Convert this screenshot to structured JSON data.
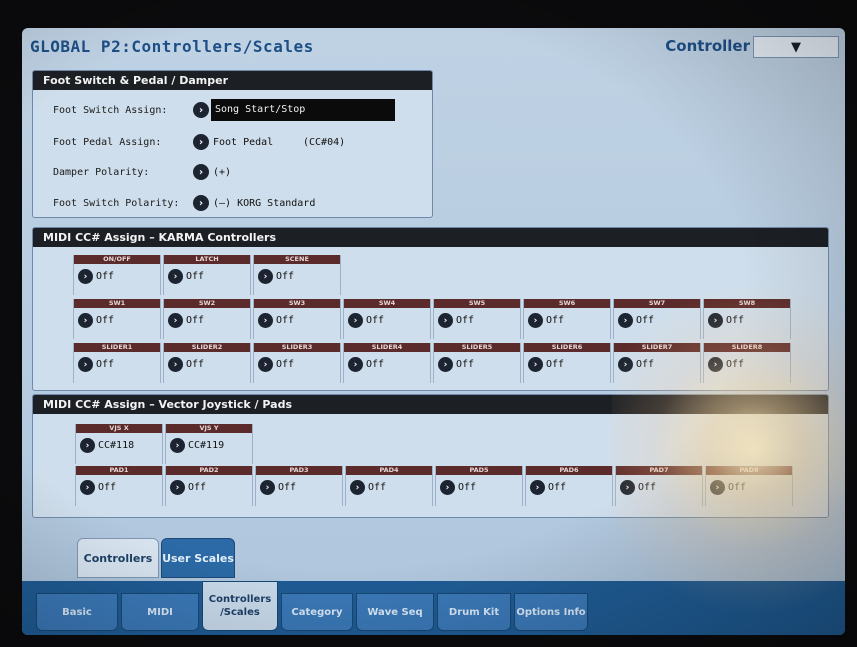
{
  "header": {
    "title": "GLOBAL P2:Controllers/Scales",
    "mode_label": "Controller",
    "mode_select_icon": "chevron-down-icon"
  },
  "foot": {
    "title": "Foot Switch & Pedal / Damper",
    "rows": [
      {
        "label": "Foot Switch Assign:",
        "value": "Song Start/Stop",
        "note": ""
      },
      {
        "label": "Foot Pedal Assign:",
        "value": "Foot Pedal",
        "note": "(CC#04)"
      },
      {
        "label": "Damper Polarity:",
        "value": "(+)",
        "note": ""
      },
      {
        "label": "Foot Switch Polarity:",
        "value": "(–) KORG Standard",
        "note": ""
      }
    ]
  },
  "karma": {
    "title": "MIDI CC# Assign – KARMA Controllers",
    "row1": [
      {
        "label": "ON/OFF",
        "value": "Off"
      },
      {
        "label": "LATCH",
        "value": "Off"
      },
      {
        "label": "SCENE",
        "value": "Off"
      }
    ],
    "row2": [
      {
        "label": "SW1",
        "value": "Off"
      },
      {
        "label": "SW2",
        "value": "Off"
      },
      {
        "label": "SW3",
        "value": "Off"
      },
      {
        "label": "SW4",
        "value": "Off"
      },
      {
        "label": "SW5",
        "value": "Off"
      },
      {
        "label": "SW6",
        "value": "Off"
      },
      {
        "label": "SW7",
        "value": "Off"
      },
      {
        "label": "SW8",
        "value": "Off"
      }
    ],
    "row3": [
      {
        "label": "SLIDER1",
        "value": "Off"
      },
      {
        "label": "SLIDER2",
        "value": "Off"
      },
      {
        "label": "SLIDER3",
        "value": "Off"
      },
      {
        "label": "SLIDER4",
        "value": "Off"
      },
      {
        "label": "SLIDER5",
        "value": "Off"
      },
      {
        "label": "SLIDER6",
        "value": "Off"
      },
      {
        "label": "SLIDER7",
        "value": "Off"
      },
      {
        "label": "SLIDER8",
        "value": "Off"
      }
    ]
  },
  "vector": {
    "title": "MIDI CC# Assign – Vector Joystick / Pads",
    "row1": [
      {
        "label": "VJS X",
        "value": "CC#118"
      },
      {
        "label": "VJS Y",
        "value": "CC#119"
      }
    ],
    "row2": [
      {
        "label": "PAD1",
        "value": "Off"
      },
      {
        "label": "PAD2",
        "value": "Off"
      },
      {
        "label": "PAD3",
        "value": "Off"
      },
      {
        "label": "PAD4",
        "value": "Off"
      },
      {
        "label": "PAD5",
        "value": "Off"
      },
      {
        "label": "PAD6",
        "value": "Off"
      },
      {
        "label": "PAD7",
        "value": "Off"
      },
      {
        "label": "PAD8",
        "value": "Off"
      }
    ]
  },
  "sub_tabs": [
    {
      "label": "Controllers"
    },
    {
      "label": "User Scales"
    }
  ],
  "main_tabs": [
    {
      "label": "Basic"
    },
    {
      "label": "MIDI"
    },
    {
      "label": "Controllers /Scales"
    },
    {
      "label": "Category"
    },
    {
      "label": "Wave Seq"
    },
    {
      "label": "Drum Kit"
    },
    {
      "label": "Options Info"
    }
  ],
  "icons": {
    "select_arrow": "arrow-right-icon"
  }
}
